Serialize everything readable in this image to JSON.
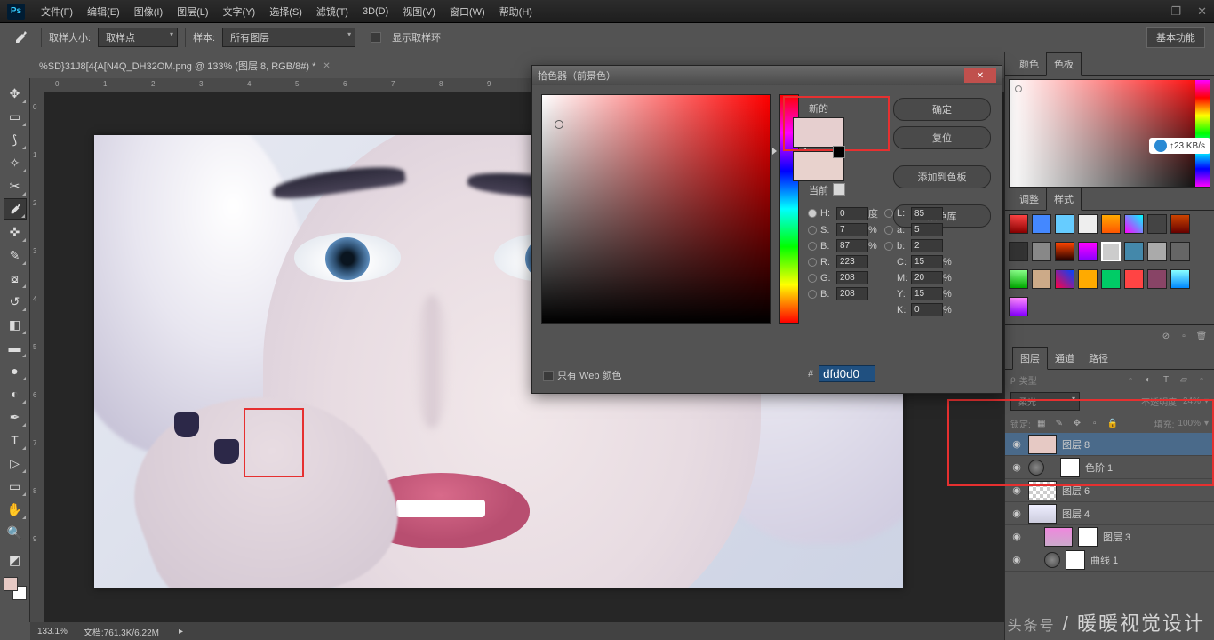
{
  "menu": {
    "file": "文件(F)",
    "edit": "编辑(E)",
    "image": "图像(I)",
    "layer": "图层(L)",
    "type": "文字(Y)",
    "select": "选择(S)",
    "filter": "滤镜(T)",
    "threed": "3D(D)",
    "view": "视图(V)",
    "window": "窗口(W)",
    "help": "帮助(H)"
  },
  "optbar": {
    "sample_size": "取样大小:",
    "sample_point": "取样点",
    "sample": "样本:",
    "all_layers": "所有图层",
    "show_ring": "显示取样环"
  },
  "feature": "基本功能",
  "doc_tab": "%SD}31J8[4{A[N4Q_DH32OM.png @ 133% (图层 8, RGB/8#) *",
  "status": {
    "zoom": "133.1%",
    "docinfo": "文档:761.3K/6.22M"
  },
  "upload": "↑23 KB/s",
  "dialog": {
    "title": "拾色器（前景色）",
    "new": "新的",
    "current": "当前",
    "ok": "确定",
    "reset": "复位",
    "add": "添加到色板",
    "lib": "颜色库",
    "H": "H:",
    "S": "S:",
    "B": "B:",
    "L": "L:",
    "a": "a:",
    "b": "b:",
    "R": "R:",
    "G": "G:",
    "Bb": "B:",
    "C": "C:",
    "M": "M:",
    "Y": "Y:",
    "K": "K:",
    "deg": "度",
    "pct": "%",
    "vH": "0",
    "vS": "7",
    "vB": "87",
    "vL": "85",
    "va": "5",
    "vb": "2",
    "vR": "223",
    "vG": "208",
    "vBb": "208",
    "vC": "15",
    "vM": "20",
    "vY": "15",
    "vK": "0",
    "hex_lbl": "#",
    "hex": "dfd0d0",
    "web": "只有 Web 颜色"
  },
  "panels": {
    "color": "颜色",
    "swatches": "色板",
    "adjust": "调整",
    "styles": "样式",
    "layers": "图层",
    "channels": "通道",
    "paths": "路径",
    "kind": "类型",
    "blend": "柔光",
    "opacity_lbl": "不透明度:",
    "opacity": "24%",
    "lock": "锁定:",
    "fill_lbl": "填充:",
    "fill": "100%"
  },
  "layers": [
    {
      "name": "图层 8"
    },
    {
      "name": "色阶 1"
    },
    {
      "name": "图层 6"
    },
    {
      "name": "图层 4"
    },
    {
      "name": "图层 3"
    },
    {
      "name": "曲线 1"
    }
  ],
  "watermark": {
    "pre": "头条号",
    "main": "暖暖视觉设计"
  }
}
